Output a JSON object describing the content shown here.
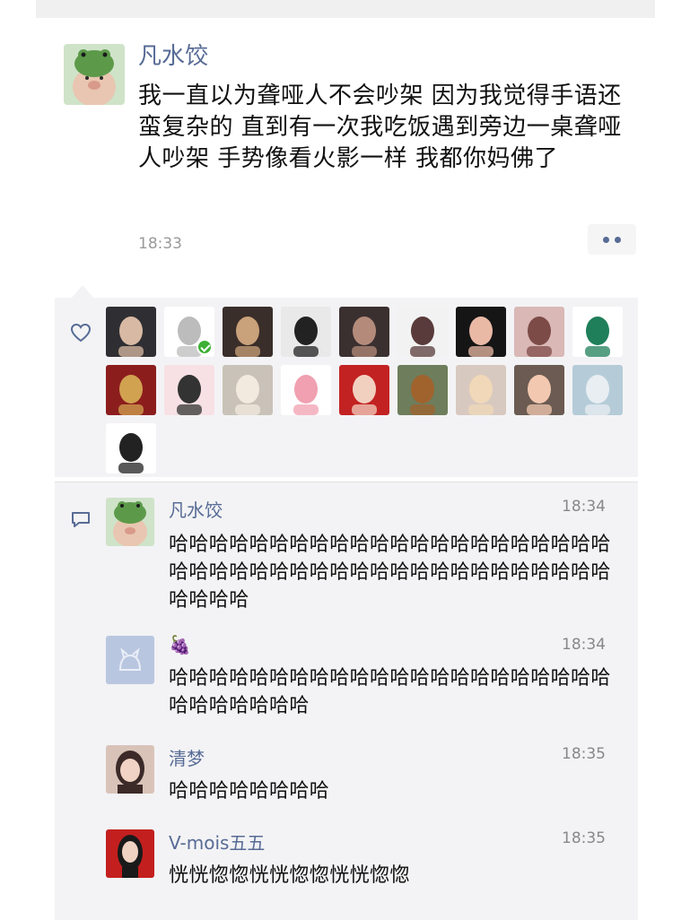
{
  "post": {
    "author": "凡水饺",
    "content": "我一直以为聋哑人不会吵架 因为我觉得手语还蛮复杂的 直到有一次我吃饭遇到旁边一桌聋哑人吵架 手势像看火影一样 我都你妈佛了",
    "time": "18:33"
  },
  "likes": {
    "avatars": [
      {
        "name": "like-avatar-1",
        "bg": "#2f2f33",
        "fg": "#d8b9a3"
      },
      {
        "name": "like-avatar-2",
        "bg": "#ffffff",
        "fg": "#bcbcbc",
        "badge": true
      },
      {
        "name": "like-avatar-3",
        "bg": "#3a2e2a",
        "fg": "#c9a17a"
      },
      {
        "name": "like-avatar-4",
        "bg": "#e9e9e9",
        "fg": "#222222"
      },
      {
        "name": "like-avatar-5",
        "bg": "#3b3030",
        "fg": "#b48b7a"
      },
      {
        "name": "like-avatar-6",
        "bg": "#f2f2f2",
        "fg": "#5a3b3b"
      },
      {
        "name": "like-avatar-7",
        "bg": "#151515",
        "fg": "#e9b9a6"
      },
      {
        "name": "like-avatar-8",
        "bg": "#d9b8b6",
        "fg": "#7d4b47"
      },
      {
        "name": "like-avatar-9",
        "bg": "#ffffff",
        "fg": "#1f7f5a"
      },
      {
        "name": "like-avatar-10",
        "bg": "#8c1d1d",
        "fg": "#d1a250"
      },
      {
        "name": "like-avatar-11",
        "bg": "#f7e1e4",
        "fg": "#333333"
      },
      {
        "name": "like-avatar-12",
        "bg": "#c9c2b8",
        "fg": "#f2e9df"
      },
      {
        "name": "like-avatar-13",
        "bg": "#ffffff",
        "fg": "#f0a0b0"
      },
      {
        "name": "like-avatar-14",
        "bg": "#c32222",
        "fg": "#f1d0c0"
      },
      {
        "name": "like-avatar-15",
        "bg": "#6e7d5b",
        "fg": "#a0632e"
      },
      {
        "name": "like-avatar-16",
        "bg": "#d8c9c0",
        "fg": "#f0d8b8"
      },
      {
        "name": "like-avatar-17",
        "bg": "#6b5b52",
        "fg": "#f2c8b0"
      },
      {
        "name": "like-avatar-18",
        "bg": "#b5ccd8",
        "fg": "#e8eef2"
      },
      {
        "name": "like-avatar-19",
        "bg": "#ffffff",
        "fg": "#222222"
      }
    ]
  },
  "comments": [
    {
      "name": "凡水饺",
      "time": "18:34",
      "text": "哈哈哈哈哈哈哈哈哈哈哈哈哈哈哈哈哈哈哈哈哈哈哈哈哈哈哈哈哈哈哈哈哈哈哈哈哈哈哈哈哈哈哈哈哈哈哈哈",
      "avatar_bg": "#cfe3c9",
      "avatar_fg": "#5c9a4a"
    },
    {
      "name": "🍇",
      "time": "18:34",
      "text": "哈哈哈哈哈哈哈哈哈哈哈哈哈哈哈哈哈哈哈哈哈哈哈哈哈哈哈哈哈",
      "avatar_bg": "#b9c6e0",
      "avatar_fg": "#e9eef8"
    },
    {
      "name": "清梦",
      "time": "18:35",
      "text": "哈哈哈哈哈哈哈哈",
      "avatar_bg": "#d9c3b9",
      "avatar_fg": "#3b2a28"
    },
    {
      "name": "V-mois五五",
      "time": "18:35",
      "text": "恍恍惚惚恍恍惚惚恍恍惚惚",
      "avatar_bg": "#c41f1f",
      "avatar_fg": "#f0d2c2"
    }
  ],
  "colors": {
    "link": "#576b95",
    "panel": "#f3f3f5",
    "time": "#999999"
  }
}
